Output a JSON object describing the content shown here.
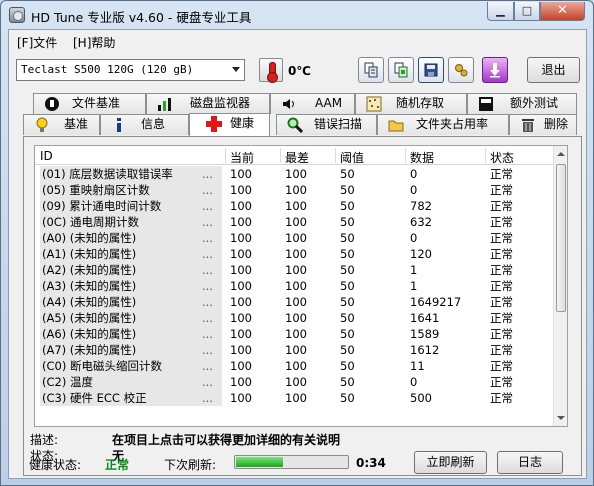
{
  "window": {
    "title": "HD Tune 专业版 v4.60 - 硬盘专业工具"
  },
  "menu": {
    "file": "[F]文件",
    "help": "[H]帮助"
  },
  "toolbar": {
    "drive": "Teclast S500 120G (120 gB)",
    "temperature": "0℃",
    "exit": "退出",
    "icons": [
      "copy-text-icon",
      "copy-screenshot-icon",
      "save-icon",
      "options-icon",
      "download-icon"
    ]
  },
  "tabs_top": [
    {
      "label": "文件基准",
      "icon": "file-benchmark-icon"
    },
    {
      "label": "磁盘监视器",
      "icon": "disk-monitor-icon"
    },
    {
      "label": "AAM",
      "icon": "speaker-icon"
    },
    {
      "label": "随机存取",
      "icon": "random-access-icon"
    },
    {
      "label": "额外测试",
      "icon": "extra-tests-icon"
    }
  ],
  "tabs_bottom": [
    {
      "label": "基准",
      "icon": "lightbulb-icon"
    },
    {
      "label": "信息",
      "icon": "info-icon"
    },
    {
      "label": "健康",
      "icon": "health-cross-icon",
      "active": true
    },
    {
      "label": "错误扫描",
      "icon": "magnifier-icon"
    },
    {
      "label": "文件夹占用率",
      "icon": "folder-icon"
    },
    {
      "label": "删除",
      "icon": "trash-icon"
    }
  ],
  "table": {
    "headers": [
      "ID",
      "当前",
      "最差",
      "阈值",
      "数据",
      "状态"
    ],
    "rows": [
      [
        "(01) 底层数据读取错误率",
        "100",
        "100",
        "50",
        "0",
        "正常"
      ],
      [
        "(05) 重映射扇区计数",
        "100",
        "100",
        "50",
        "0",
        "正常"
      ],
      [
        "(09) 累计通电时间计数",
        "100",
        "100",
        "50",
        "782",
        "正常"
      ],
      [
        "(0C) 通电周期计数",
        "100",
        "100",
        "50",
        "632",
        "正常"
      ],
      [
        "(A0) (未知的属性)",
        "100",
        "100",
        "50",
        "0",
        "正常"
      ],
      [
        "(A1) (未知的属性)",
        "100",
        "100",
        "50",
        "120",
        "正常"
      ],
      [
        "(A2) (未知的属性)",
        "100",
        "100",
        "50",
        "1",
        "正常"
      ],
      [
        "(A3) (未知的属性)",
        "100",
        "100",
        "50",
        "1",
        "正常"
      ],
      [
        "(A4) (未知的属性)",
        "100",
        "100",
        "50",
        "1649217",
        "正常"
      ],
      [
        "(A5) (未知的属性)",
        "100",
        "100",
        "50",
        "1641",
        "正常"
      ],
      [
        "(A6) (未知的属性)",
        "100",
        "100",
        "50",
        "1589",
        "正常"
      ],
      [
        "(A7) (未知的属性)",
        "100",
        "100",
        "50",
        "1612",
        "正常"
      ],
      [
        "(C0) 断电磁头缩回计数",
        "100",
        "100",
        "50",
        "11",
        "正常"
      ],
      [
        "(C2) 温度",
        "100",
        "100",
        "50",
        "0",
        "正常"
      ],
      [
        "(C3) 硬件 ECC 校正",
        "100",
        "100",
        "50",
        "500",
        "正常"
      ]
    ],
    "ellipsis": "..."
  },
  "description": {
    "desc_label": "描述:",
    "desc_value": "在项目上点击可以获得更加详细的有关说明",
    "status_label": "状态:",
    "status_value": "无"
  },
  "footer": {
    "health_label": "健康状态:",
    "health_value": "正常",
    "next_refresh_label": "下次刷新:",
    "countdown": "0:34",
    "progress": 0.42,
    "refresh_button": "立即刷新",
    "log_button": "日志"
  },
  "colors": {
    "health_ok": "#0a8a1c",
    "progress_fill": "#1ba71b"
  }
}
